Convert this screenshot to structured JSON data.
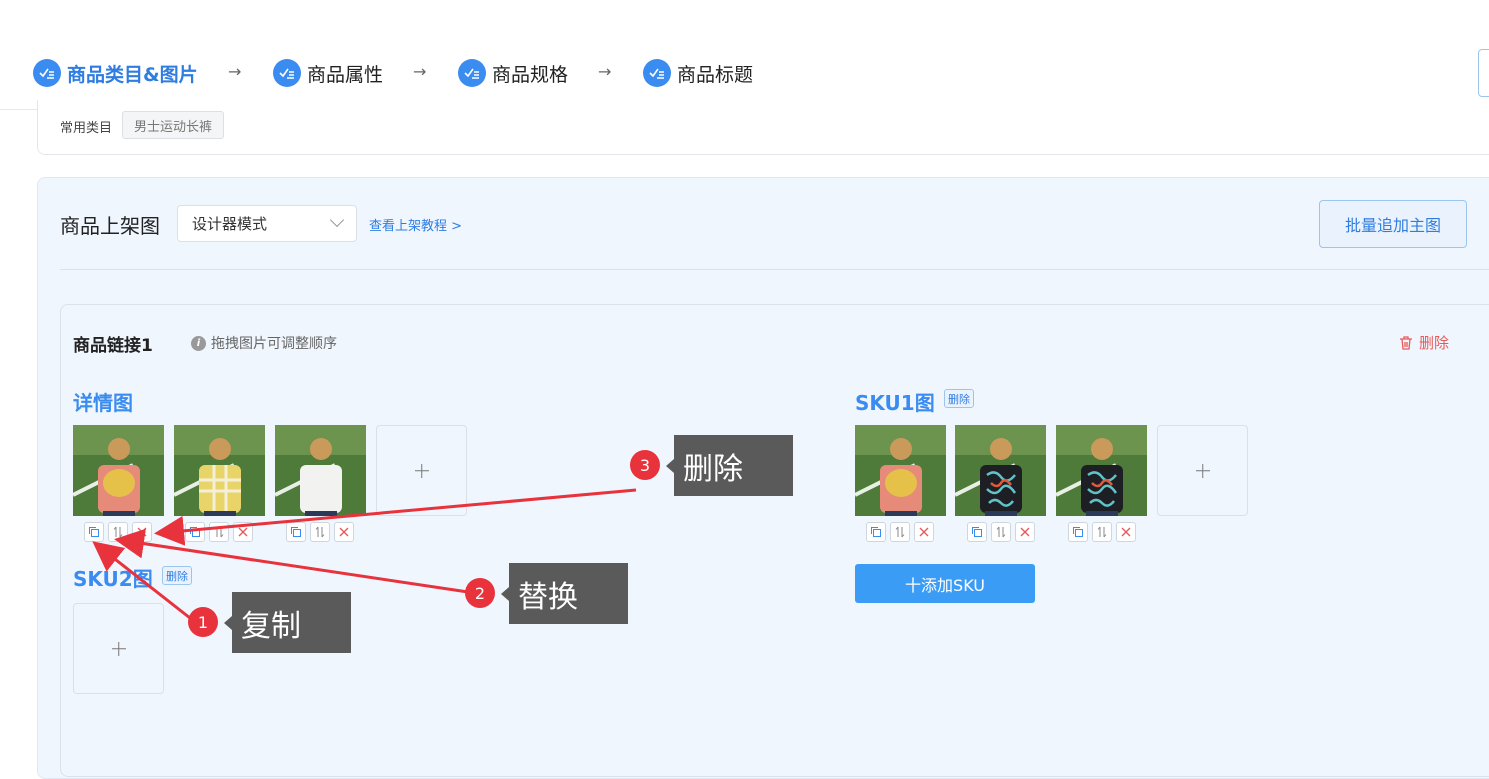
{
  "steps": [
    {
      "label": "商品类目&图片",
      "active": true
    },
    {
      "label": "商品属性",
      "active": false
    },
    {
      "label": "商品规格",
      "active": false
    },
    {
      "label": "商品标题",
      "active": false
    }
  ],
  "category": {
    "label": "常用类目",
    "tag": "男士运动长裤"
  },
  "panel": {
    "title": "商品上架图",
    "select_value": "设计器模式",
    "tutorial_link": "查看上架教程 >",
    "batch_button": "批量追加主图"
  },
  "link_card": {
    "title": "商品链接1",
    "hint": "拖拽图片可调整顺序",
    "delete": "删除"
  },
  "sections": {
    "detail": {
      "title": "详情图"
    },
    "sku1": {
      "title": "SKU1图",
      "delete": "删除"
    },
    "sku2": {
      "title": "SKU2图",
      "delete": "删除"
    }
  },
  "add_sku_button": "十添加SKU",
  "annotations": [
    {
      "num": "1",
      "text": "复制"
    },
    {
      "num": "2",
      "text": "替换"
    },
    {
      "num": "3",
      "text": "删除"
    }
  ],
  "colors": {
    "accent": "#3b8cf0",
    "danger": "#e65a5a",
    "annotation_red": "#e8323c",
    "panel_bg": "#f0f6fe"
  }
}
